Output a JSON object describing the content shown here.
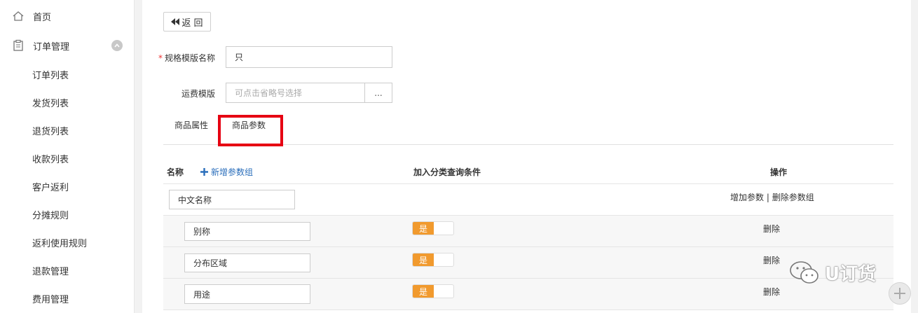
{
  "sidebar": {
    "home": "首页",
    "order_mgmt": "订单管理",
    "items": [
      "订单列表",
      "发货列表",
      "退货列表",
      "收款列表",
      "客户返利",
      "分摊规则",
      "返利使用规则",
      "退款管理",
      "费用管理"
    ]
  },
  "toolbar": {
    "back_label": "返 回"
  },
  "form": {
    "name_label": "规格模版名称",
    "name_value": "只",
    "shipping_label": "运费模版",
    "shipping_placeholder": "可点击省略号选择",
    "dots_label": "..."
  },
  "tabs": [
    {
      "label": "商品属性"
    },
    {
      "label": "商品参数"
    }
  ],
  "table": {
    "col_name": "名称",
    "add_group": "新增参数组",
    "col_query": "加入分类查询条件",
    "col_ops": "操作",
    "group": {
      "name": "中文名称",
      "add_param": "增加参数",
      "sep": "|",
      "delete_group": "删除参数组"
    },
    "params": [
      {
        "name": "别称",
        "toggle": "是",
        "op": "删除"
      },
      {
        "name": "分布区域",
        "toggle": "是",
        "op": "删除"
      },
      {
        "name": "用途",
        "toggle": "是",
        "op": "删除"
      }
    ]
  },
  "watermark": {
    "text": "U订货"
  },
  "colors": {
    "accent_orange": "#f19a2e",
    "highlight_red": "#e60012",
    "link_blue": "#2a6ebb"
  }
}
